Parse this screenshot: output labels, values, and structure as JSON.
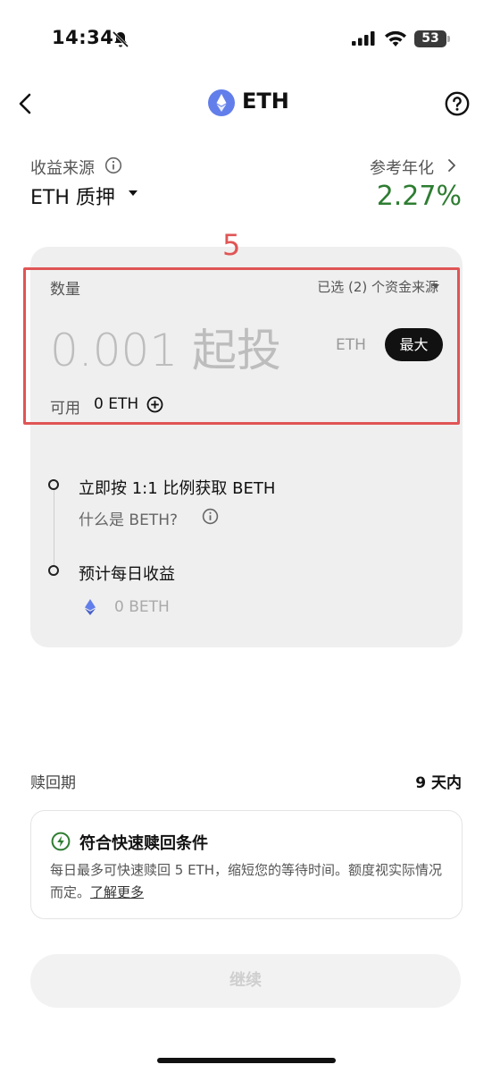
{
  "status_bar": {
    "time": "14:34",
    "battery": "53"
  },
  "header": {
    "title": "ETH"
  },
  "source": {
    "label": "收益来源",
    "value": "ETH 质押"
  },
  "apy": {
    "label": "参考年化",
    "value": "2.27%"
  },
  "annotation": {
    "number": "5"
  },
  "amount": {
    "label": "数量",
    "sources_selector": "已选 (2) 个资金来源",
    "placeholder": "0.001 起投",
    "unit": "ETH",
    "max_label": "最大",
    "available_label": "可用",
    "available_value": "0 ETH"
  },
  "timeline": {
    "step1": "立即按 1:1 比例获取 BETH",
    "beth_link": "什么是 BETH?",
    "step2": "预计每日收益",
    "beth_amount": "0  BETH"
  },
  "redemption": {
    "label": "赎回期",
    "value": "9 天内",
    "fast_title": "符合快速赎回条件",
    "fast_desc": "每日最多可快速赎回 5 ETH，缩短您的等待时间。额度视实际情况而定。",
    "learn_more": "了解更多"
  },
  "continue_label": "继续",
  "colors": {
    "apy_green": "#2e7d32",
    "annotation_red": "#e05555",
    "eth_blue": "#627eea"
  },
  "icons": [
    "bell-off-icon",
    "signal-icon",
    "wifi-icon",
    "battery-icon",
    "back-icon",
    "eth-logo-icon",
    "help-icon",
    "info-icon",
    "chevron-right-icon",
    "plus-circle-icon",
    "beth-icon",
    "bolt-icon"
  ]
}
